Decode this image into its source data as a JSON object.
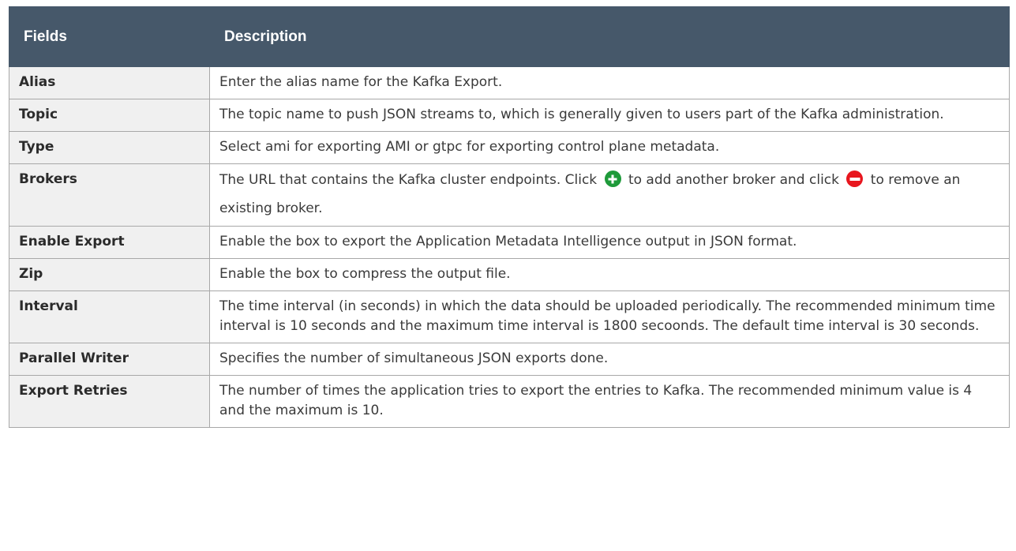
{
  "table": {
    "headers": {
      "fields": "Fields",
      "description": "Description"
    },
    "rows": [
      {
        "field": "Alias",
        "description": "Enter the alias name for the Kafka Export."
      },
      {
        "field": "Topic",
        "description": "The topic name to push JSON streams to, which is generally given to users part of the Kafka administration."
      },
      {
        "field": "Type",
        "description": "Select ami for exporting AMI or gtpc for exporting control plane metadata."
      },
      {
        "field": "Brokers",
        "description_parts": {
          "before_add": "The URL that contains the Kafka cluster endpoints. Click",
          "between": "to add another broker and click",
          "after_remove": "to remove an existing broker."
        },
        "icons": {
          "add": "add-circle-icon",
          "remove": "remove-circle-icon"
        }
      },
      {
        "field": "Enable Export",
        "description": "Enable the box to export the Application Metadata Intelligence output in JSON format."
      },
      {
        "field": "Zip",
        "description": "Enable the box to compress the output file."
      },
      {
        "field": "Interval",
        "description": "The time interval (in seconds) in which the data should be uploaded periodically. The recommended minimum time interval is 10 seconds and the maximum time interval is 1800 secoonds. The default time interval is 30 seconds."
      },
      {
        "field": "Parallel Writer",
        "description": "Specifies the number of simultaneous JSON exports done."
      },
      {
        "field": "Export Retries",
        "description": "The number of times the application tries to export the entries to Kafka. The recommended minimum value is 4 and the maximum is 10."
      }
    ]
  },
  "colors": {
    "header_bg": "#46586a",
    "header_text": "#ffffff",
    "field_bg": "#f0f0f0",
    "border": "#a8a8a8",
    "add_icon": "#1e9a3a",
    "remove_icon": "#e8161e"
  }
}
